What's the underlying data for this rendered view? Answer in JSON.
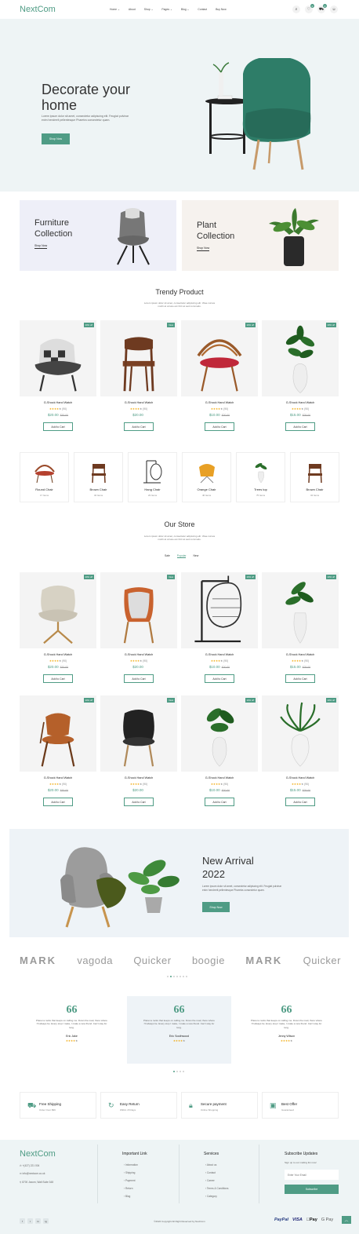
{
  "header": {
    "logo": "NextCom",
    "nav": [
      "Home ⌄",
      "About",
      "Shop ⌄",
      "Pages ⌄",
      "Blog ⌄",
      "Contact",
      "Buy Now"
    ],
    "wishlist_count": "0",
    "cart_count": "0"
  },
  "hero": {
    "title_line1": "Decorate your",
    "title_line2": "home",
    "text_line1": "Lorem ipsum dolor sit amet, consectetur adipiscing elit. Feugiat pulvinar",
    "text_line2": "enim hendrerit pellentesque Pharetra consectetur quam.",
    "button": "Shop Now"
  },
  "collections": [
    {
      "line1": "Furniture",
      "line2": "Collection",
      "link": "Shop Now"
    },
    {
      "line1": "Plant",
      "line2": "Collection",
      "link": "Shop Now"
    }
  ],
  "trendy": {
    "title": "Trendy Product",
    "sub1": "Lorem ipsum dolor sit amet, consectetur adipiscing elit. Vitae cursus",
    "sub2": "morbi at ornare est Orci at sed commodo.",
    "products": [
      {
        "tag": "20% off",
        "name": "G-Shock Hand Watch",
        "reviews": "(90)",
        "price": "$20.00",
        "old": "$30.00",
        "btn": "Add to Cart"
      },
      {
        "tag": "New",
        "name": "G-Shock Hand Watch",
        "reviews": "(90)",
        "price": "$20.00",
        "old": "",
        "btn": "Add to Cart"
      },
      {
        "tag": "20% off",
        "name": "G-Shock Hand Watch",
        "reviews": "(90)",
        "price": "$10.00",
        "old": "$20.00",
        "btn": "Add to Cart"
      },
      {
        "tag": "20% off",
        "name": "G-Shock Hand Watch",
        "reviews": "(90)",
        "price": "$15.00",
        "old": "$25.00",
        "btn": "Add to Cart"
      }
    ]
  },
  "categories": [
    {
      "name": "Round Chair",
      "count": "17 Items"
    },
    {
      "name": "Brown Chair",
      "count": "34 Items"
    },
    {
      "name": "Hang Chair",
      "count": "23 Items"
    },
    {
      "name": "Orange Chair",
      "count": "46 Items"
    },
    {
      "name": "Trees top",
      "count": "75 Items"
    },
    {
      "name": "Brown Chair",
      "count": "34 Items"
    }
  ],
  "store": {
    "title": "Our Store",
    "sub1": "Lorem ipsum dolor sit amet, consectetur adipiscing elit. Vitae cursus",
    "sub2": "morbi at ornare est Orci at sed commodo.",
    "tabs": [
      "Sale",
      "Popular",
      "New"
    ],
    "products": [
      {
        "tag": "20% off",
        "name": "G-Shock Hand Watch",
        "reviews": "(90)",
        "price": "$20.00",
        "old": "$30.00",
        "btn": "Add to Cart"
      },
      {
        "tag": "New",
        "name": "G-Shock Hand Watch",
        "reviews": "(90)",
        "price": "$20.00",
        "old": "",
        "btn": "Add to Cart"
      },
      {
        "tag": "20% off",
        "name": "G-Shock Hand Watch",
        "reviews": "(90)",
        "price": "$10.00",
        "old": "$20.00",
        "btn": "Add to Cart"
      },
      {
        "tag": "20% off",
        "name": "G-Shock Hand Watch",
        "reviews": "(90)",
        "price": "$15.00",
        "old": "$25.00",
        "btn": "Add to Cart"
      },
      {
        "tag": "20% off",
        "name": "G-Shock Hand Watch",
        "reviews": "(90)",
        "price": "$20.00",
        "old": "$30.00",
        "btn": "Add to Cart"
      },
      {
        "tag": "New",
        "name": "G-Shock Hand Watch",
        "reviews": "(90)",
        "price": "$20.00",
        "old": "",
        "btn": "Add to Cart"
      },
      {
        "tag": "20% off",
        "name": "G-Shock Hand Watch",
        "reviews": "(90)",
        "price": "$10.00",
        "old": "$20.00",
        "btn": "Add to Cart"
      },
      {
        "tag": "20% off",
        "name": "G-Shock Hand Watch",
        "reviews": "(90)",
        "price": "$15.00",
        "old": "$25.00",
        "btn": "Add to Cart"
      }
    ]
  },
  "arrival": {
    "line1": "New Arrival",
    "line2": "2022",
    "text1": "Lorem ipsum dolor sit amet, consectetur adipiscing elit. Feugiat pulvinar",
    "text2": "enim hendrerit pellentesque Pharetra consectetur quam.",
    "button": "Shop Now"
  },
  "brands": [
    "MARK",
    "vagoda",
    "Quicker",
    "boogie",
    "MARK",
    "Quicker"
  ],
  "testimonials": [
    {
      "quote": "66",
      "text1": "Planet a rocks that keeps on calling me. Down the road, there where",
      "text2": "I'll always be. Every stop I make, I make a new friend. Can't stay for",
      "text3": "long.",
      "name": "Eric Jake"
    },
    {
      "quote": "66",
      "text1": "Planet a rocks that keeps on calling me. Down the road, there where",
      "text2": "I'll always be. Every stop I make, I make a new friend. Can't stay for",
      "text3": "long.",
      "name": "Eric Southwood"
    },
    {
      "quote": "66",
      "text1": "Planet a rocks that keeps on calling me. Down the road, there where",
      "text2": "I'll always be. Every stop I make, I make a new friend. Can't stay for",
      "text3": "long.",
      "name": "Jenny Wilson"
    }
  ],
  "features": [
    {
      "title": "Free Shipping",
      "sub": "Order Over $99"
    },
    {
      "title": "Easy Return",
      "sub": "Within 15 Days"
    },
    {
      "title": "Secure payment",
      "sub": "Online Shopping"
    },
    {
      "title": "Best Offer",
      "sub": "Guaranteed"
    }
  ],
  "footer": {
    "logo": "NextCom",
    "phone": "+(427) 221 004",
    "email": "info@nextcom.co.uk",
    "address": "8700 Jaxom, Walt Suite 348",
    "important_title": "Important Link",
    "important": [
      "Information",
      "Shipping",
      "Payment",
      "Return",
      "Blog"
    ],
    "services_title": "Services",
    "services": [
      "About us",
      "Contact",
      "Career",
      "Terms & Conditions",
      "Category"
    ],
    "subscribe_title": "Subscribe Updates",
    "subscribe_text": "Sign up to our mailing list now!",
    "email_placeholder": "Enter Your Email",
    "subscribe_btn": "Subscribe",
    "copyright": "©2022 Copyright All Right Reserved by NextCom",
    "payments": [
      "PayPal",
      "VISA",
      "Pay",
      "G Pay"
    ],
    "social": [
      "f",
      "t",
      "in",
      "ig"
    ]
  }
}
